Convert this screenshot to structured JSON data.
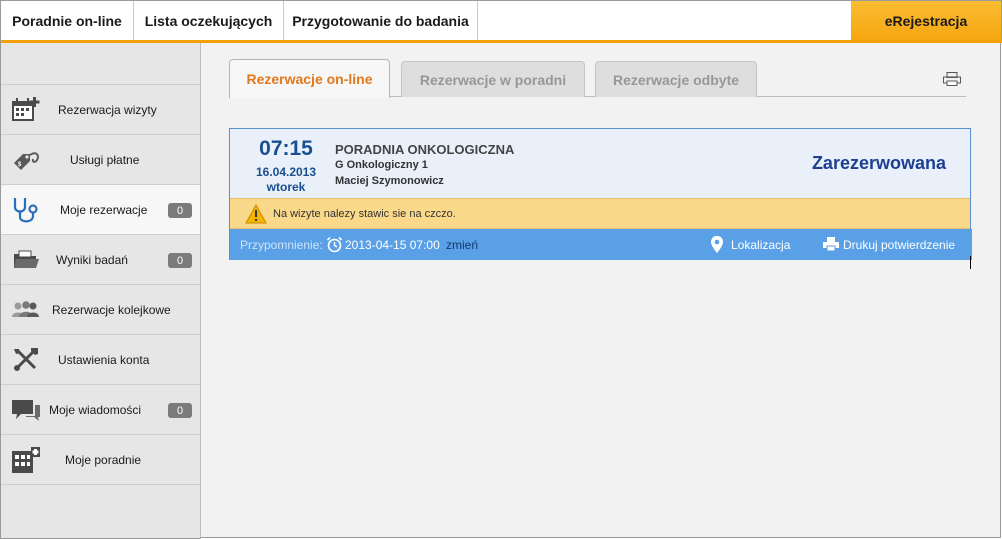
{
  "topnav": {
    "tabs": [
      "Poradnie on-line",
      "Lista oczekujących",
      "Przygotowanie do badania"
    ],
    "ereg": "eRejestracja"
  },
  "sidebar": {
    "items": [
      {
        "label": "Rezerwacja wizyty",
        "icon": "calendar-add-icon"
      },
      {
        "label": "Usługi płatne",
        "icon": "price-tag-stethoscope-icon"
      },
      {
        "label": "Moje rezerwacje",
        "icon": "stethoscope-icon",
        "badge": "0"
      },
      {
        "label": "Wyniki badań",
        "icon": "folder-icon",
        "badge": "0"
      },
      {
        "label": "Rezerwacje kolejkowe",
        "icon": "people-queue-icon"
      },
      {
        "label": "Ustawienia konta",
        "icon": "tools-icon"
      },
      {
        "label": "Moje wiadomości",
        "icon": "chat-bubbles-icon",
        "badge": "0"
      },
      {
        "label": "Moje poradnie",
        "icon": "building-icon"
      }
    ]
  },
  "subtabs": [
    "Rezerwacje on-line",
    "Rezerwacje w poradni",
    "Rezerwacje odbyte"
  ],
  "reservation": {
    "time": "07:15",
    "date": "16.04.2013",
    "weekday": "wtorek",
    "clinic": "PORADNIA ONKOLOGICZNA",
    "unit": "G Onkologiczny 1",
    "doctor": "Maciej Szymonowicz",
    "status": "Zarezerwowana",
    "warning": "Na wizyte nalezy stawic sie na czczo.",
    "reminder_label": "Przypomnienie:",
    "reminder_datetime": "2013-04-15 07:00",
    "change": "zmień",
    "location": "Lokalizacja",
    "print": "Drukuj potwierdzenie"
  },
  "colors": {
    "accent": "#f2a100",
    "active_tab": "#e2781b",
    "status": "#1c3f92",
    "footer": "#5aa0e6",
    "warning": "#fbd98b"
  }
}
